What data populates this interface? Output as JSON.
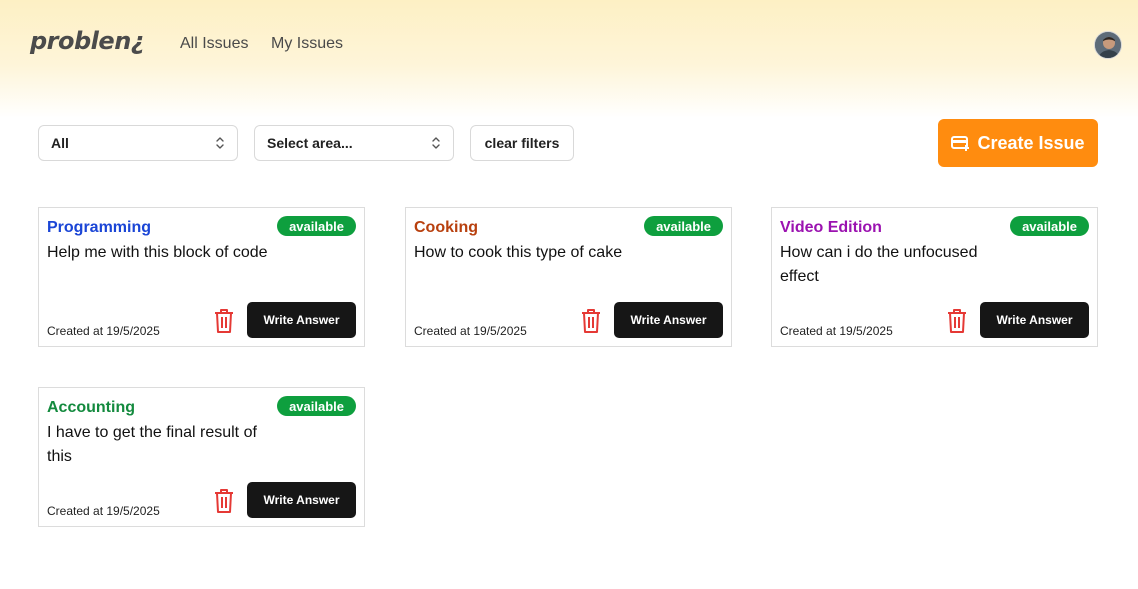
{
  "header": {
    "logo": "problen¿",
    "nav": [
      "All Issues",
      "My Issues"
    ]
  },
  "filters": {
    "status_value": "All",
    "area_placeholder": "Select area...",
    "clear_label": "clear filters"
  },
  "create_label": "Create Issue",
  "colors": {
    "accent": "#ff8c0f",
    "badge": "#0e9f3e",
    "programming": "#1a45d6",
    "cooking": "#b8400e",
    "video": "#9b12b0",
    "accounting": "#138a3e"
  },
  "cards": [
    {
      "category": "Programming",
      "status": "available",
      "title": "Help me with this block of code",
      "created": "Created at 19/5/2025",
      "action": "Write Answer",
      "color": "#1a45d6"
    },
    {
      "category": "Cooking",
      "status": "available",
      "title": "How to cook this type of cake",
      "created": "Created at 19/5/2025",
      "action": "Write Answer",
      "color": "#b8400e"
    },
    {
      "category": "Video Edition",
      "status": "available",
      "title": "How can i do the unfocused effect",
      "created": "Created at 19/5/2025",
      "action": "Write Answer",
      "color": "#9b12b0"
    },
    {
      "category": "Accounting",
      "status": "available",
      "title": "I have to get the final result of this",
      "created": "Created at 19/5/2025",
      "action": "Write Answer",
      "color": "#138a3e"
    }
  ]
}
